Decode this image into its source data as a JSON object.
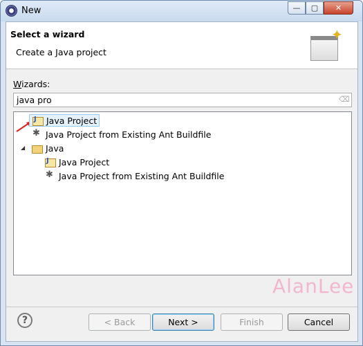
{
  "window": {
    "title": "New",
    "minimize": "—",
    "maximize": "▢",
    "close": "✕"
  },
  "header": {
    "title": "Select a wizard",
    "subtitle": "Create a Java project"
  },
  "wizards_label_first": "W",
  "wizards_label_rest": "izards:",
  "filter": {
    "value": "java pro"
  },
  "tree": {
    "items": [
      {
        "label": "Java Project",
        "icon": "java-project-icon",
        "selected": true
      },
      {
        "label": "Java Project from Existing Ant Buildfile",
        "icon": "ant-icon"
      },
      {
        "label": "Java",
        "icon": "folder-icon",
        "expanded": true
      },
      {
        "label": "Java Project",
        "icon": "java-project-icon"
      },
      {
        "label": "Java Project from Existing Ant Buildfile",
        "icon": "ant-icon"
      }
    ]
  },
  "watermark": "AlanLee",
  "buttons": {
    "help": "?",
    "back": "< Back",
    "next": "Next >",
    "finish": "Finish",
    "cancel": "Cancel"
  }
}
